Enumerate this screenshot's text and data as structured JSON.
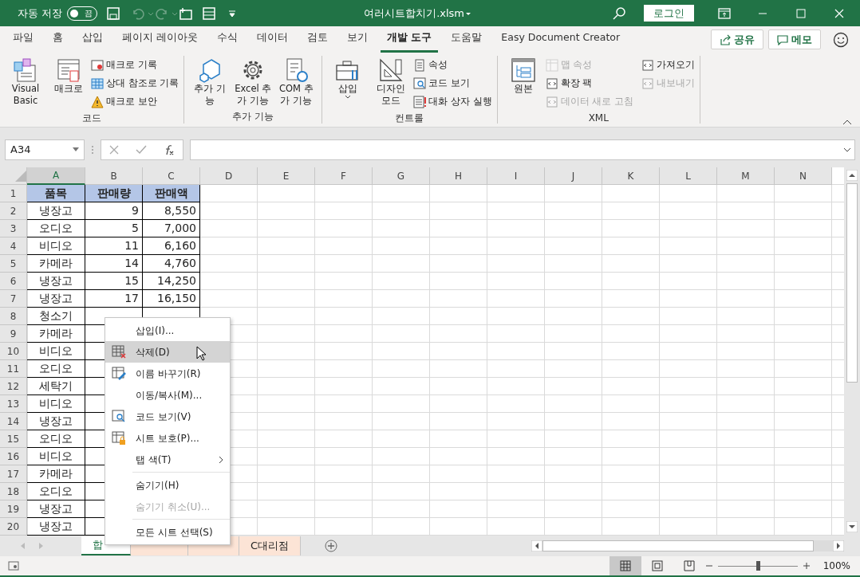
{
  "title_bar": {
    "autosave_label": "자동 저장",
    "autosave_toggle": {
      "on": false,
      "label": "끔"
    },
    "filename": "여러시트합치기.xlsm",
    "login": "로그인"
  },
  "ribbon_tabs": [
    {
      "label": "파일",
      "selected": false
    },
    {
      "label": "홈",
      "selected": false
    },
    {
      "label": "삽입",
      "selected": false
    },
    {
      "label": "페이지 레이아웃",
      "selected": false
    },
    {
      "label": "수식",
      "selected": false
    },
    {
      "label": "데이터",
      "selected": false
    },
    {
      "label": "검토",
      "selected": false
    },
    {
      "label": "보기",
      "selected": false
    },
    {
      "label": "개발 도구",
      "selected": true
    },
    {
      "label": "도움말",
      "selected": false
    },
    {
      "label": "Easy Document Creator",
      "selected": false
    }
  ],
  "share_button": "공유",
  "memo_button": "메모",
  "ribbon_groups": [
    {
      "label": "코드",
      "items": [
        {
          "kind": "large",
          "label": "Visual Basic",
          "disabled": false
        },
        {
          "kind": "large",
          "label": "매크로",
          "disabled": false
        },
        {
          "kind": "small",
          "label": "매크로 기록",
          "disabled": false
        },
        {
          "kind": "small",
          "label": "상대 참조로 기록",
          "disabled": false
        },
        {
          "kind": "small",
          "label": "매크로 보안",
          "disabled": false
        }
      ]
    },
    {
      "label": "추가 기능",
      "items": [
        {
          "kind": "large",
          "label": "추가 기능",
          "disabled": false
        },
        {
          "kind": "large",
          "label": "Excel 추가 기능",
          "disabled": false
        },
        {
          "kind": "large",
          "label": "COM 추가 기능",
          "disabled": false
        }
      ]
    },
    {
      "label": "컨트롤",
      "items": [
        {
          "kind": "large",
          "label": "삽입",
          "caret": true,
          "disabled": false
        },
        {
          "kind": "large",
          "label": "디자인 모드",
          "disabled": false
        },
        {
          "kind": "small",
          "label": "속성",
          "disabled": false
        },
        {
          "kind": "small",
          "label": "코드 보기",
          "disabled": false
        },
        {
          "kind": "small",
          "label": "대화 상자 실행",
          "disabled": false
        }
      ]
    },
    {
      "label": "XML",
      "items": [
        {
          "kind": "large",
          "label": "원본",
          "disabled": false
        },
        {
          "kind": "small",
          "label": "맵 속성",
          "disabled": true
        },
        {
          "kind": "small",
          "label": "확장 팩",
          "disabled": false
        },
        {
          "kind": "small",
          "label": "데이터 새로 고침",
          "disabled": true
        },
        {
          "kind": "small",
          "label": "가져오기",
          "disabled": false
        },
        {
          "kind": "small",
          "label": "내보내기",
          "disabled": true
        }
      ]
    }
  ],
  "formula_bar": {
    "name_box": "A34"
  },
  "columns": [
    {
      "label": "A",
      "selected": true
    },
    {
      "label": "B",
      "selected": false
    },
    {
      "label": "C",
      "selected": false
    },
    {
      "label": "D",
      "selected": false
    },
    {
      "label": "E",
      "selected": false
    },
    {
      "label": "F",
      "selected": false
    },
    {
      "label": "G",
      "selected": false
    },
    {
      "label": "H",
      "selected": false
    },
    {
      "label": "I",
      "selected": false
    },
    {
      "label": "J",
      "selected": false
    },
    {
      "label": "K",
      "selected": false
    },
    {
      "label": "L",
      "selected": false
    },
    {
      "label": "M",
      "selected": false
    },
    {
      "label": "N",
      "selected": false
    }
  ],
  "rows": [
    {
      "number": "1",
      "kind": "header",
      "cells": [
        "품목",
        "판매량",
        "판매액"
      ]
    },
    {
      "number": "2",
      "kind": "data",
      "cells": [
        "냉장고",
        "9",
        "8,550"
      ]
    },
    {
      "number": "3",
      "kind": "data",
      "cells": [
        "오디오",
        "5",
        "7,000"
      ]
    },
    {
      "number": "4",
      "kind": "data",
      "cells": [
        "비디오",
        "11",
        "6,160"
      ]
    },
    {
      "number": "5",
      "kind": "data",
      "cells": [
        "카메라",
        "14",
        "4,760"
      ]
    },
    {
      "number": "6",
      "kind": "data",
      "cells": [
        "냉장고",
        "15",
        "14,250"
      ]
    },
    {
      "number": "7",
      "kind": "data",
      "cells": [
        "냉장고",
        "17",
        "16,150"
      ]
    },
    {
      "number": "8",
      "kind": "data",
      "cells": [
        "청소기"
      ]
    },
    {
      "number": "9",
      "kind": "data",
      "cells": [
        "카메라"
      ]
    },
    {
      "number": "10",
      "kind": "data",
      "cells": [
        "비디오"
      ]
    },
    {
      "number": "11",
      "kind": "data",
      "cells": [
        "오디오"
      ]
    },
    {
      "number": "12",
      "kind": "data",
      "cells": [
        "세탁기"
      ]
    },
    {
      "number": "13",
      "kind": "data",
      "cells": [
        "비디오"
      ]
    },
    {
      "number": "14",
      "kind": "data",
      "cells": [
        "냉장고"
      ]
    },
    {
      "number": "15",
      "kind": "data",
      "cells": [
        "오디오"
      ]
    },
    {
      "number": "16",
      "kind": "data",
      "cells": [
        "비디오"
      ]
    },
    {
      "number": "17",
      "kind": "data",
      "cells": [
        "카메라"
      ]
    },
    {
      "number": "18",
      "kind": "data",
      "cells": [
        "오디오"
      ]
    },
    {
      "number": "19",
      "kind": "data",
      "cells": [
        "냉장고"
      ]
    },
    {
      "number": "20",
      "kind": "data",
      "cells": [
        "냉장고"
      ]
    }
  ],
  "context_menu": [
    {
      "kind": "item",
      "label": "삽입(I)...",
      "selected": false,
      "disabled": false
    },
    {
      "kind": "item",
      "label": "삭제(D)",
      "selected": true,
      "disabled": false
    },
    {
      "kind": "item",
      "label": "이름 바꾸기(R)",
      "selected": false,
      "disabled": false
    },
    {
      "kind": "item",
      "label": "이동/복사(M)...",
      "selected": false,
      "disabled": false
    },
    {
      "kind": "item",
      "label": "코드 보기(V)",
      "selected": false,
      "disabled": false
    },
    {
      "kind": "item",
      "label": "시트 보호(P)...",
      "selected": false,
      "disabled": false
    },
    {
      "kind": "item",
      "label": "탭 색(T)",
      "selected": false,
      "disabled": false,
      "submenu": true
    },
    {
      "kind": "separator"
    },
    {
      "kind": "item",
      "label": "숨기기(H)",
      "selected": false,
      "disabled": false
    },
    {
      "kind": "item",
      "label": "숨기기 취소(U)...",
      "selected": false,
      "disabled": true
    },
    {
      "kind": "separator"
    },
    {
      "kind": "item",
      "label": "모든 시트 선택(S)",
      "selected": false,
      "disabled": false
    }
  ],
  "sheet_tabs": [
    {
      "label": "합",
      "selected": true,
      "color": "#ffffff"
    },
    {
      "selected": false,
      "color": "#fce4d6"
    },
    {
      "selected": false,
      "color": "#fce4d6"
    },
    {
      "label": "C대리점",
      "selected": false,
      "color": "#fce4d6"
    }
  ],
  "status_bar": {
    "views": [
      {
        "selected": true
      },
      {
        "selected": false
      },
      {
        "selected": false
      }
    ],
    "zoom": {
      "level": 0.5,
      "reading": "100%"
    }
  }
}
